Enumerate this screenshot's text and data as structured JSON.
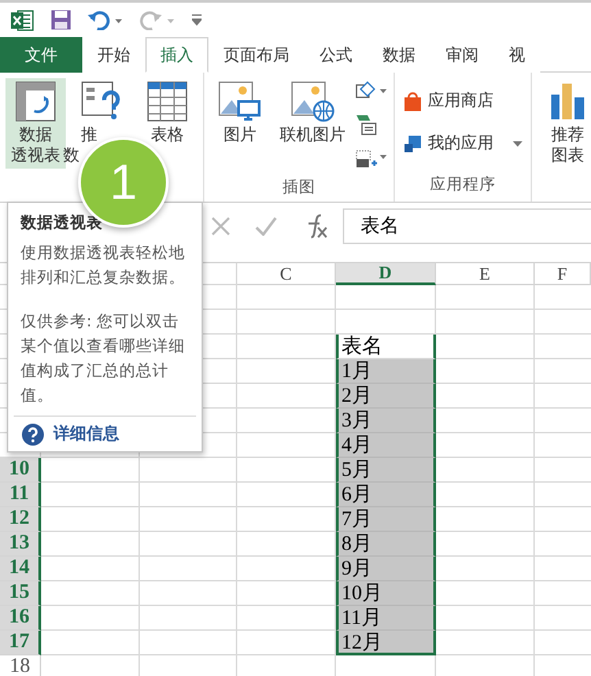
{
  "tabs": [
    {
      "label": "文件",
      "kind": "file",
      "selected": false
    },
    {
      "label": "开始",
      "kind": "tab",
      "selected": false
    },
    {
      "label": "插入",
      "kind": "tab",
      "selected": true
    },
    {
      "label": "页面布局",
      "kind": "tab",
      "selected": false
    },
    {
      "label": "公式",
      "kind": "tab",
      "selected": false
    },
    {
      "label": "数据",
      "kind": "tab",
      "selected": false
    },
    {
      "label": "审阅",
      "kind": "tab",
      "selected": false
    },
    {
      "label": "视",
      "kind": "tab",
      "selected": false
    }
  ],
  "ribbon": {
    "groups": [
      {
        "buttons": [
          {
            "kind": "large",
            "lines": [
              "数据",
              "透视表"
            ],
            "hovered": true
          },
          {
            "kind": "large",
            "lines": [
              "推",
              "数"
            ],
            "hovered": false
          },
          {
            "kind": "large",
            "lines": [
              "表格"
            ],
            "hovered": false
          }
        ]
      },
      {
        "label": "插图",
        "buttons": [
          {
            "kind": "large",
            "lines": [
              "图片"
            ],
            "hovered": false
          },
          {
            "kind": "large",
            "lines": [
              "联机图片"
            ],
            "hovered": false
          },
          {
            "kind": "stack",
            "hovered": false
          }
        ]
      },
      {
        "label": "应用程序",
        "buttons": [
          {
            "kind": "row",
            "lines": [
              "应用商店"
            ],
            "hovered": false
          },
          {
            "kind": "row",
            "lines": [
              "我的应用"
            ],
            "dropdown": true,
            "hovered": false
          }
        ]
      },
      {
        "buttons": [
          {
            "kind": "large",
            "lines": [
              "推荐",
              "图表"
            ],
            "hovered": false
          }
        ]
      }
    ]
  },
  "callout": "1",
  "tooltip": {
    "title": "数据透视表",
    "description": "使用数据透视表轻松地排列和汇总复杂数据。",
    "note": "仅供参考: 您可以双击某个值以查看哪些详细值构成了汇总的总计值。",
    "link": "详细信息"
  },
  "formula_bar": {
    "value": "表名"
  },
  "columns": [
    {
      "letter": "C",
      "selected": false
    },
    {
      "letter": "D",
      "selected": true
    },
    {
      "letter": "E",
      "selected": false
    },
    {
      "letter": "F",
      "selected": false
    }
  ],
  "rows": [
    {},
    {},
    {
      "value": "表名",
      "shaded": false
    },
    {
      "value": "1月",
      "shaded": true
    },
    {
      "value": "2月",
      "shaded": true
    },
    {
      "value": "3月",
      "shaded": true
    },
    {
      "value": "4月",
      "shaded": true
    },
    {
      "number": "10",
      "selected": true,
      "value": "5月",
      "shaded": true
    },
    {
      "number": "11",
      "selected": true,
      "value": "6月",
      "shaded": true
    },
    {
      "number": "12",
      "selected": true,
      "value": "7月",
      "shaded": true
    },
    {
      "number": "13",
      "selected": true,
      "value": "8月",
      "shaded": true
    },
    {
      "number": "14",
      "selected": true,
      "value": "9月",
      "shaded": true
    },
    {
      "number": "15",
      "selected": true,
      "value": "10月",
      "shaded": true
    },
    {
      "number": "16",
      "selected": true,
      "value": "11月",
      "shaded": true
    },
    {
      "number": "17",
      "selected": true,
      "value": "12月",
      "shaded": true
    },
    {
      "number": "18",
      "selected": false
    }
  ]
}
